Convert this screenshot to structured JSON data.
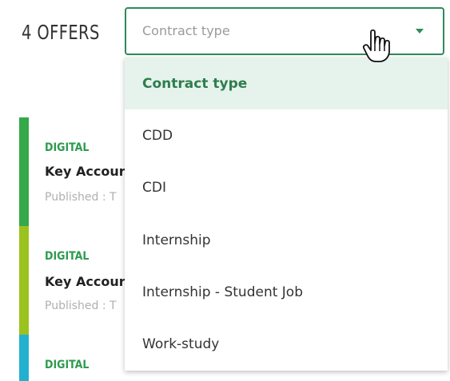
{
  "offers_count": "4 OFFERS",
  "filter": {
    "placeholder": "Contract type",
    "options": [
      {
        "label": "Contract type",
        "selected": true
      },
      {
        "label": "CDD"
      },
      {
        "label": "CDI"
      },
      {
        "label": "Internship"
      },
      {
        "label": "Internship - Student Job"
      },
      {
        "label": "Work-study"
      }
    ]
  },
  "offers": [
    {
      "category": "DIGITAL",
      "title": "Key Accour",
      "published": "Published : T",
      "bar_color": "#35a84a"
    },
    {
      "category": "DIGITAL",
      "title": "Key Accour",
      "published": "Published : T",
      "bar_color": "#9cc21f"
    },
    {
      "category": "DIGITAL",
      "title": "",
      "published": "",
      "bar_color": "#23b0d0"
    }
  ],
  "colors": {
    "accent": "#2f8a5a",
    "selected_bg": "#e6f3ec",
    "category": "#2e9a4f"
  }
}
